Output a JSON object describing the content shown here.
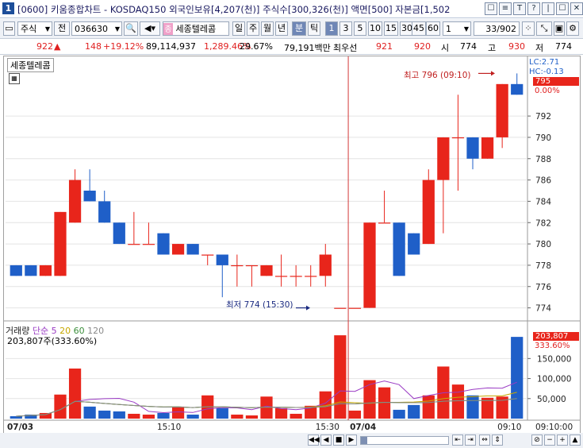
{
  "window": {
    "number": "1",
    "title": "[0600] 키움종합차트 - KOSDAQ150 외국인보유[4,207(천)] 주식수[300,326(천)] 액면[500] 자본금[1,502",
    "controls": [
      "☐",
      "≡",
      "T",
      "?",
      "|",
      "☐",
      "✕"
    ]
  },
  "toolbar": {
    "market": "주식",
    "market_btn": "전",
    "code": "036630",
    "stock_name": "세종텔레콤",
    "name_prefix": "종",
    "periods": [
      "일",
      "주",
      "월",
      "년",
      "분",
      "틱"
    ],
    "selected_period": "분",
    "intervals": [
      "1",
      "3",
      "5",
      "10",
      "15",
      "30",
      "45",
      "60"
    ],
    "selected_interval": "1",
    "unit": "1",
    "page": "33",
    "page_total": "/902"
  },
  "info": {
    "price": "922",
    "arrow": "▲",
    "change": "148",
    "change_pct": "+19.12%",
    "volume": "89,114,937",
    "volume_pct": "1,289.46%",
    "turnover": "29.67%",
    "amount": "79,191백만",
    "best_label": "최우선",
    "best_ask": "921",
    "best_bid": "920",
    "open_label": "시",
    "open": "774",
    "high_label": "고",
    "high": "930",
    "low_label": "저",
    "low": "774"
  },
  "price_panel": {
    "legend": "세종텔레콤",
    "lc": "LC:2.71",
    "hc": "HC:-0.13",
    "current_label": "795",
    "current_pct": "0.00%",
    "annot_high": "최고 796 (09:10)",
    "annot_low": "최저 774 (15:30)"
  },
  "volume_panel": {
    "legend_volume": "거래량",
    "legend_ma": "단순",
    "ma_periods": [
      "5",
      "20",
      "60",
      "120"
    ],
    "current_value": "203,807주(333.60%)",
    "current_label": "203,807",
    "current_pct": "333.60%"
  },
  "x_axis": {
    "labels": [
      "07/03",
      "15:10",
      "15:30",
      "07/04",
      "09:10"
    ],
    "right_label": "09:10:00"
  },
  "colors": {
    "up": "#e8251b",
    "down": "#1f5fc8",
    "grid": "#e4e4e4",
    "ma5": "#9a3bc4",
    "ma20": "#c7a800",
    "ma60": "#3c8f3c",
    "ma120": "#8a8a8a"
  },
  "chart_data": {
    "type": "candlestick",
    "y_ticks": [
      774,
      776,
      778,
      780,
      782,
      784,
      786,
      788,
      790,
      792
    ],
    "vol_ticks": [
      "50,000",
      "100,000",
      "150,000"
    ],
    "vol_tick_values": [
      50000,
      100000,
      150000
    ],
    "ylim": [
      773,
      797
    ],
    "vol_max": 230000,
    "candles": [
      {
        "o": 778,
        "c": 777,
        "h": 778,
        "l": 777,
        "v": 6000
      },
      {
        "o": 778,
        "c": 777,
        "h": 778,
        "l": 777,
        "v": 10000
      },
      {
        "o": 777,
        "c": 778,
        "h": 778,
        "l": 777,
        "v": 14000
      },
      {
        "o": 777,
        "c": 783,
        "h": 783,
        "l": 777,
        "v": 60000
      },
      {
        "o": 782,
        "c": 786,
        "h": 787,
        "l": 782,
        "v": 125000
      },
      {
        "o": 785,
        "c": 784,
        "h": 787,
        "l": 784,
        "v": 30000
      },
      {
        "o": 784,
        "c": 782,
        "h": 785,
        "l": 782,
        "v": 20000
      },
      {
        "o": 782,
        "c": 780,
        "h": 782,
        "l": 780,
        "v": 18000
      },
      {
        "o": 780,
        "c": 780,
        "h": 783,
        "l": 780,
        "v": 12000
      },
      {
        "o": 780,
        "c": 780,
        "h": 782,
        "l": 780,
        "v": 10000
      },
      {
        "o": 781,
        "c": 779,
        "h": 781,
        "l": 779,
        "v": 14000
      },
      {
        "o": 779,
        "c": 780,
        "h": 780,
        "l": 779,
        "v": 30000
      },
      {
        "o": 780,
        "c": 779,
        "h": 780,
        "l": 779,
        "v": 10000
      },
      {
        "o": 779,
        "c": 779,
        "h": 779,
        "l": 778,
        "v": 58000
      },
      {
        "o": 779,
        "c": 778,
        "h": 779,
        "l": 775,
        "v": 26000
      },
      {
        "o": 778,
        "c": 778,
        "h": 779,
        "l": 776,
        "v": 10000
      },
      {
        "o": 778,
        "c": 778,
        "h": 778,
        "l": 776,
        "v": 8000
      },
      {
        "o": 777,
        "c": 778,
        "h": 778,
        "l": 777,
        "v": 55000
      },
      {
        "o": 777,
        "c": 777,
        "h": 779,
        "l": 776,
        "v": 26000
      },
      {
        "o": 777,
        "c": 777,
        "h": 778,
        "l": 776,
        "v": 12000
      },
      {
        "o": 777,
        "c": 777,
        "h": 778,
        "l": 776,
        "v": 32000
      },
      {
        "o": 777,
        "c": 779,
        "h": 780,
        "l": 776,
        "v": 68000
      },
      {
        "o": 774,
        "c": 774,
        "h": 774,
        "l": 774,
        "v": 208000
      },
      {
        "o": 774,
        "c": 774,
        "h": 774,
        "l": 774,
        "v": 20000
      },
      {
        "o": 774,
        "c": 782,
        "h": 782,
        "l": 774,
        "v": 96000
      },
      {
        "o": 782,
        "c": 782,
        "h": 785,
        "l": 782,
        "v": 78000
      },
      {
        "o": 782,
        "c": 777,
        "h": 782,
        "l": 777,
        "v": 22000
      },
      {
        "o": 781,
        "c": 779,
        "h": 781,
        "l": 779,
        "v": 34000
      },
      {
        "o": 780,
        "c": 786,
        "h": 787,
        "l": 780,
        "v": 58000
      },
      {
        "o": 786,
        "c": 790,
        "h": 790,
        "l": 781,
        "v": 130000
      },
      {
        "o": 790,
        "c": 790,
        "h": 794,
        "l": 785,
        "v": 85000
      },
      {
        "o": 790,
        "c": 788,
        "h": 790,
        "l": 787,
        "v": 58000
      },
      {
        "o": 788,
        "c": 790,
        "h": 790,
        "l": 788,
        "v": 52000
      },
      {
        "o": 790,
        "c": 795,
        "h": 795,
        "l": 789,
        "v": 55000
      },
      {
        "o": 795,
        "c": 794,
        "h": 796,
        "l": 794,
        "v": 204000
      }
    ]
  }
}
